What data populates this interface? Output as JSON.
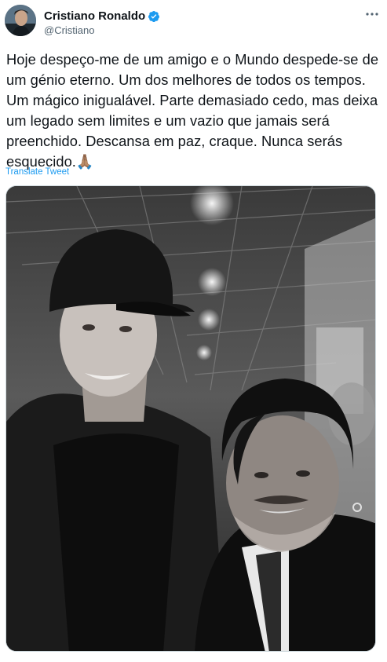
{
  "tweet": {
    "author": {
      "display_name": "Cristiano Ronaldo",
      "handle": "@Cristiano",
      "verified": true
    },
    "more_icon": "more-horizontal-icon",
    "text": "Hoje despeço-me de um amigo e o Mundo despede-se de um génio eterno. Um dos melhores de todos os tempos. Um mágico inigualável. Parte demasiado cedo, mas deixa um legado sem limites e um vazio que jamais será preenchido. Descansa em paz, craque. Nunca serás esquecido.🙏🏽",
    "translate_label": "Translate Tweet"
  },
  "colors": {
    "link_blue": "#1d9bf0",
    "verified_blue": "#1d9bf0",
    "secondary_text": "#536471"
  }
}
